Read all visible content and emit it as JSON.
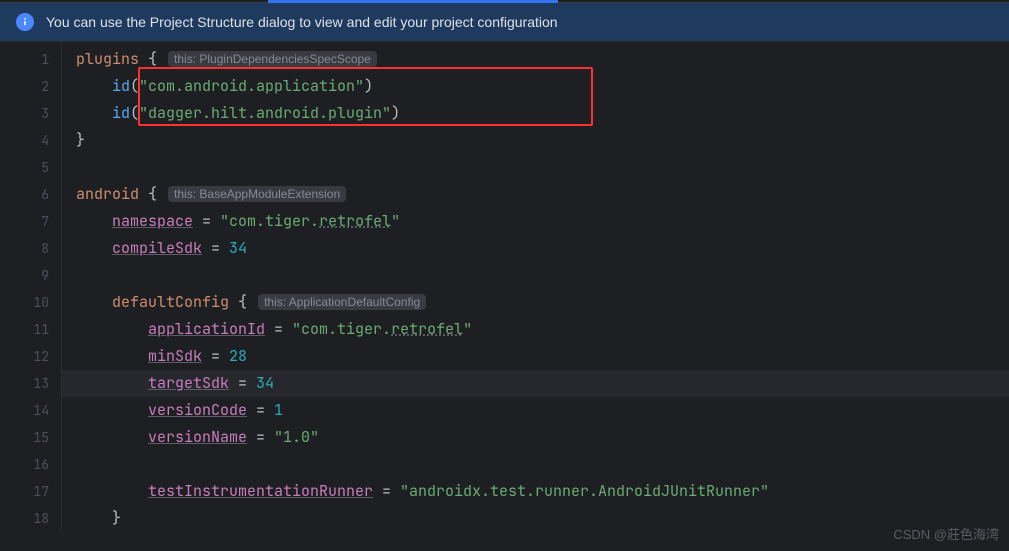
{
  "banner": {
    "text": "You can use the Project Structure dialog to view and edit your project configuration"
  },
  "lines": [
    "1",
    "2",
    "3",
    "4",
    "5",
    "6",
    "7",
    "8",
    "9",
    "10",
    "11",
    "12",
    "13",
    "14",
    "15",
    "16",
    "17",
    "18"
  ],
  "hints": {
    "plugins": "this: PluginDependenciesSpecScope",
    "android": "this: BaseAppModuleExtension",
    "defaultConfig": "this: ApplicationDefaultConfig"
  },
  "code": {
    "plugins_kw": "plugins",
    "id_fn": "id",
    "plugin1": "\"com.android.application\"",
    "plugin2": "\"dagger.hilt.android.plugin\"",
    "android_kw": "android",
    "namespace_prop": "namespace",
    "namespace_val_pre": "\"com.tiger.",
    "namespace_val_dash": "retrofel",
    "namespace_val_post": "\"",
    "compileSdk_prop": "compileSdk",
    "compileSdk_val": "34",
    "defaultConfig_kw": "defaultConfig",
    "applicationId_prop": "applicationId",
    "applicationId_val_pre": "\"com.tiger.",
    "applicationId_val_dash": "retrofel",
    "applicationId_val_post": "\"",
    "minSdk_prop": "minSdk",
    "minSdk_val": "28",
    "targetSdk_prop": "targetSdk",
    "targetSdk_val": "34",
    "versionCode_prop": "versionCode",
    "versionCode_val": "1",
    "versionName_prop": "versionName",
    "versionName_val": "\"1.0\"",
    "testRunner_prop": "testInstrumentationRunner",
    "testRunner_val": "\"androidx.test.runner.AndroidJUnitRunner\"",
    "eq": " = ",
    "obrace": " {",
    "cbrace": "}",
    "oparen": "(",
    "cparen": ")"
  },
  "watermark": "CSDN @莊色海湾"
}
